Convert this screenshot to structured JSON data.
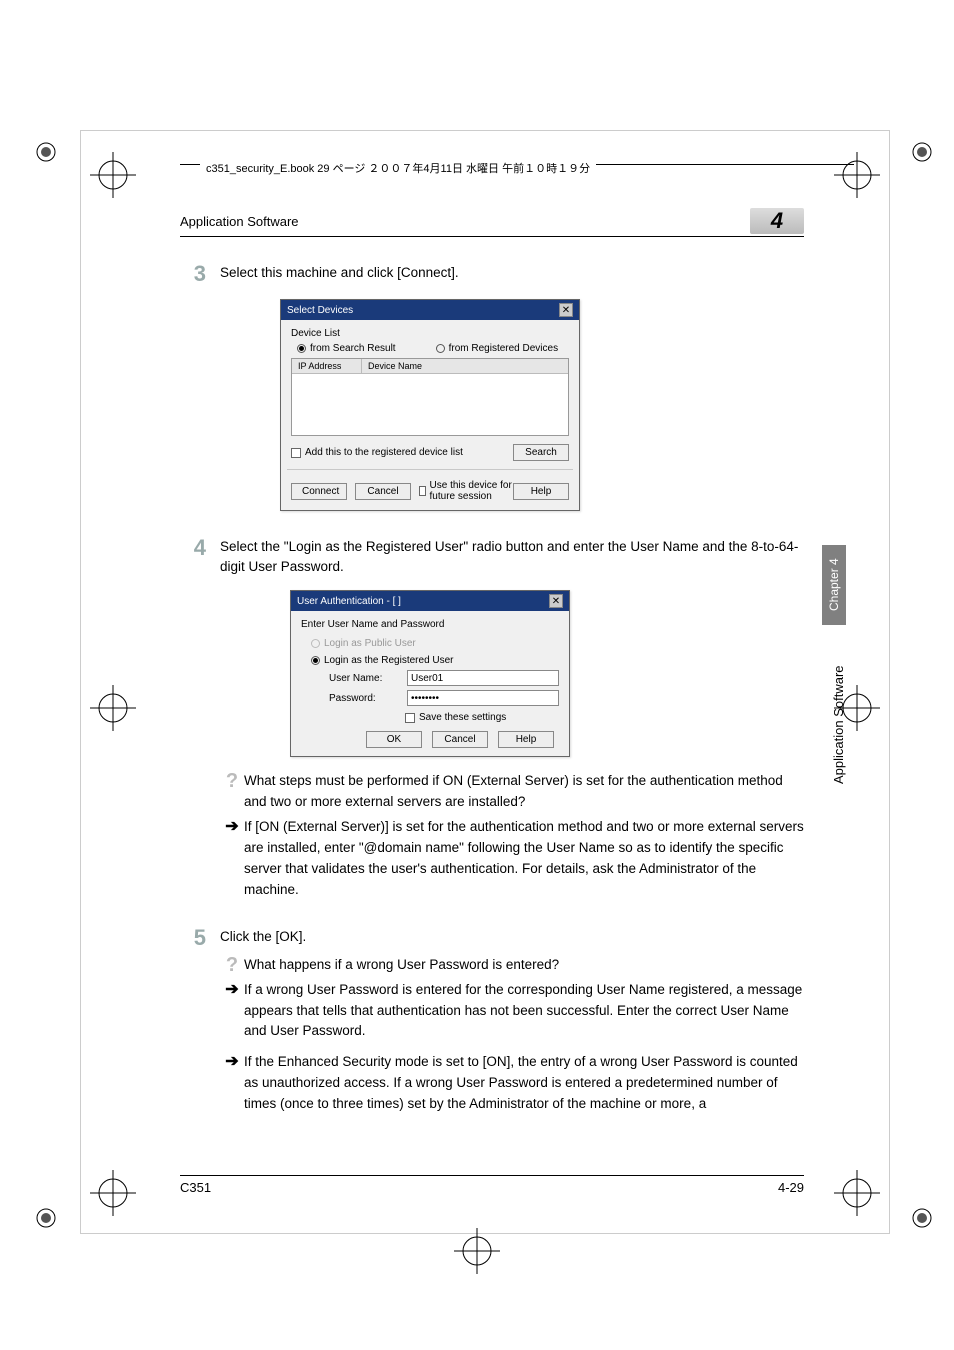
{
  "book_label": "c351_security_E.book  29 ページ  ２００７年4月11日  水曜日  午前１０時１９分",
  "header": {
    "section": "Application Software",
    "chapter_num": "4"
  },
  "side": {
    "chapter": "Chapter 4",
    "section": "Application Software"
  },
  "steps": {
    "s3": {
      "num": "3",
      "text": "Select this machine and click [Connect]."
    },
    "s4": {
      "num": "4",
      "text": "Select the \"Login as the Registered User\" radio button and enter the User Name and the 8-to-64-digit User Password."
    },
    "s5": {
      "num": "5",
      "text": "Click the [OK]."
    }
  },
  "dlg1": {
    "title": "Select Devices",
    "group": "Device List",
    "opt_search": "from Search Result",
    "opt_reg": "from Registered Devices",
    "col_ip": "IP Address",
    "col_name": "Device Name",
    "chk_add": "Add this to the registered device list",
    "btn_search": "Search",
    "btn_connect": "Connect",
    "btn_cancel": "Cancel",
    "chk_future": "Use this device for future session",
    "btn_help": "Help"
  },
  "dlg2": {
    "title": "User Authentication - [                        ]",
    "heading": "Enter User Name and Password",
    "opt_public": "Login as Public User",
    "opt_reg": "Login as the Registered User",
    "lbl_user": "User Name:",
    "val_user": "User01",
    "lbl_pass": "Password:",
    "val_pass": "********",
    "chk_save": "Save these settings",
    "btn_ok": "OK",
    "btn_cancel": "Cancel",
    "btn_help": "Help"
  },
  "qa": {
    "q1": "What steps must be performed if ON (External Server) is set for the authentication method and two or more external servers are installed?",
    "a1": "If [ON (External Server)] is set for the authentication method and two or more external servers are installed, enter \"@domain name\" following the User Name so as to identify the specific server that validates the user's authentication. For details, ask the Administrator of the machine.",
    "q2": "What happens if a wrong User Password is entered?",
    "a2": "If a wrong User Password is entered for the corresponding User Name registered, a message appears that tells that authentication has not been successful. Enter the correct User Name and User Password.",
    "a3": "If the Enhanced Security mode is set to [ON], the entry of a wrong User Password is counted as unauthorized access. If a wrong User Password is entered a predetermined number of times (once to three times) set by the Administrator of the machine or more, a"
  },
  "footer": {
    "model": "C351",
    "page": "4-29"
  }
}
